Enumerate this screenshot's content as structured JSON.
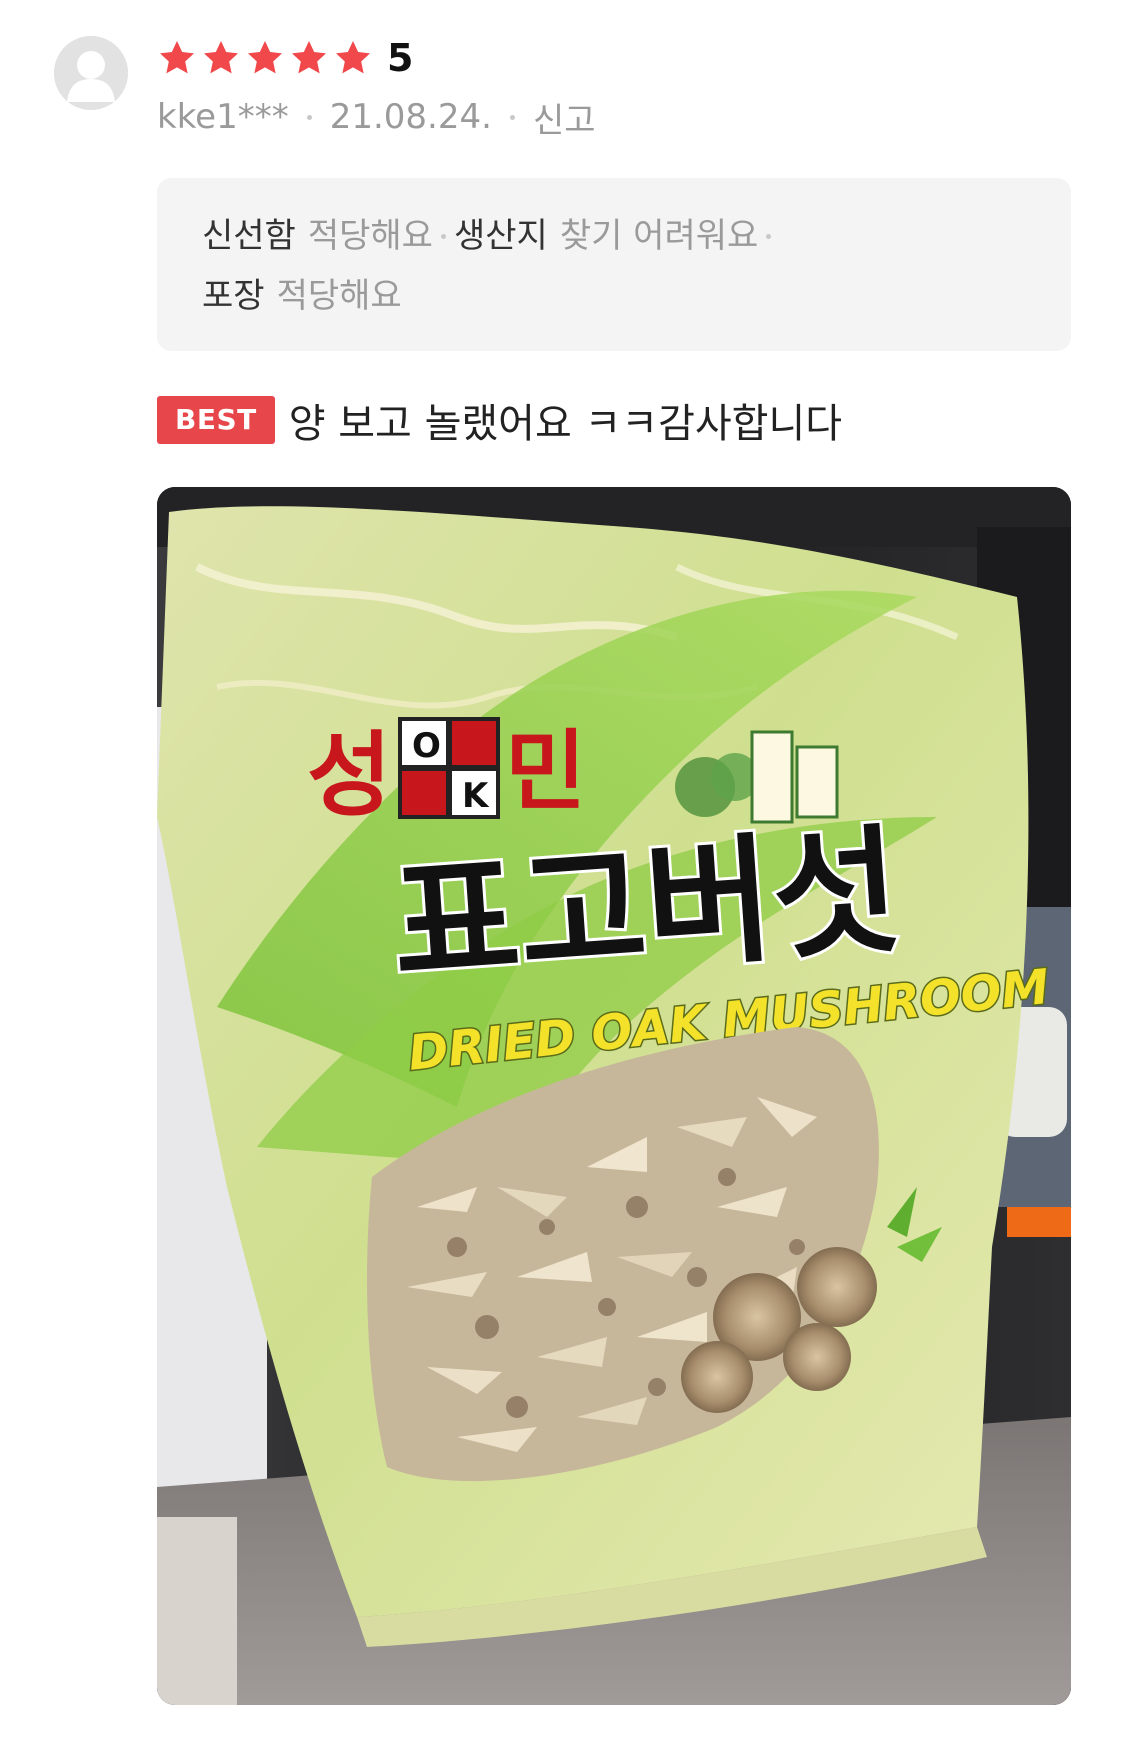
{
  "review": {
    "rating_value": "5",
    "star_count": 5,
    "star_color": "#f0484b",
    "user": "kke1***",
    "date": "21.08.24.",
    "report_label": "신고",
    "survey": [
      {
        "label": "신선함",
        "value": "적당해요"
      },
      {
        "label": "생산지",
        "value": "찾기 어려워요"
      },
      {
        "label": "포장",
        "value": "적당해요"
      }
    ],
    "best_badge": "BEST",
    "text": "양 보고 놀랬어요 ㅋㅋ감사합니다"
  },
  "photo": {
    "package_brand_left": "성",
    "package_brand_right": "민",
    "package_logo_top": "O",
    "package_logo_bottom": "K",
    "package_title": "표고버섯",
    "package_subtitle": "DRIED OAK MUSHROOM"
  }
}
